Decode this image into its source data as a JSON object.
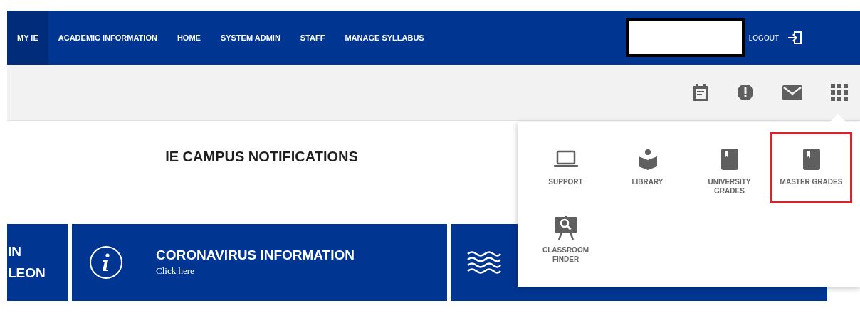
{
  "nav": {
    "tabs": [
      {
        "label": "MY IE",
        "selected": true
      },
      {
        "label": "ACADEMIC INFORMATION",
        "selected": false
      },
      {
        "label": "HOME",
        "selected": false
      },
      {
        "label": "SYSTEM ADMIN",
        "selected": false
      },
      {
        "label": "STAFF",
        "selected": false
      },
      {
        "label": "MANAGE SYLLABUS",
        "selected": false
      }
    ],
    "logout": "LOGOUT"
  },
  "page": {
    "title": "IE CAMPUS NOTIFICATIONS"
  },
  "cards": [
    {
      "kind": "text",
      "lines": [
        "IN",
        "LEON"
      ]
    },
    {
      "kind": "info",
      "title": "CORONAVIRUS INFORMATION",
      "subtitle": "Click here"
    },
    {
      "kind": "waves"
    }
  ],
  "apps_menu": {
    "expanded": true,
    "items": [
      {
        "kind": "laptop",
        "label": "SUPPORT",
        "highlighted": false
      },
      {
        "kind": "reader",
        "label": "LIBRARY",
        "highlighted": false
      },
      {
        "kind": "book",
        "label": "UNIVERSITY GRADES",
        "highlighted": false
      },
      {
        "kind": "book",
        "label": "MASTER GRADES",
        "highlighted": true
      },
      {
        "kind": "easel",
        "label": "CLASSROOM FINDER",
        "highlighted": false
      }
    ]
  }
}
